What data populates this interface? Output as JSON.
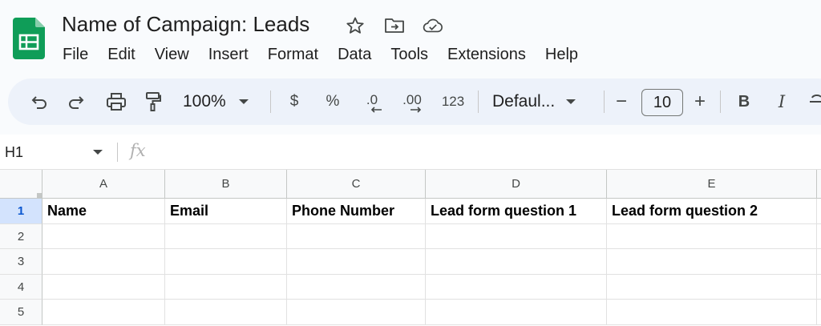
{
  "document": {
    "title": "Name of Campaign: Leads"
  },
  "menu": [
    "File",
    "Edit",
    "View",
    "Insert",
    "Format",
    "Data",
    "Tools",
    "Extensions",
    "Help"
  ],
  "toolbar": {
    "zoom": "100%",
    "currency": "$",
    "percent": "%",
    "decrease_decimal": ".0",
    "increase_decimal": ".00",
    "number_format": "123",
    "font": "Defaul...",
    "font_size": "10",
    "minus": "−",
    "plus": "+",
    "bold": "B",
    "italic": "I"
  },
  "formula_bar": {
    "cell_ref": "H1",
    "fx": "fx",
    "value": ""
  },
  "grid": {
    "columns": [
      "A",
      "B",
      "C",
      "D",
      "E"
    ],
    "rows": [
      "1",
      "2",
      "3",
      "4",
      "5"
    ],
    "selected_row": "1",
    "header_row": [
      "Name",
      "Email",
      "Phone Number",
      "Lead form question 1",
      "Lead form question 2"
    ]
  },
  "icons": {
    "app": "sheets-logo-icon",
    "star": "star-icon",
    "move": "move-to-folder-icon",
    "cloud": "cloud-saved-icon",
    "undo": "undo-icon",
    "redo": "redo-icon",
    "print": "print-icon",
    "paint": "paint-format-icon",
    "strike": "strikethrough-icon"
  },
  "colors": {
    "accent": "#0f9d58",
    "selected_row_bg": "#d3e3fd",
    "selected_row_fg": "#0b57d0"
  }
}
